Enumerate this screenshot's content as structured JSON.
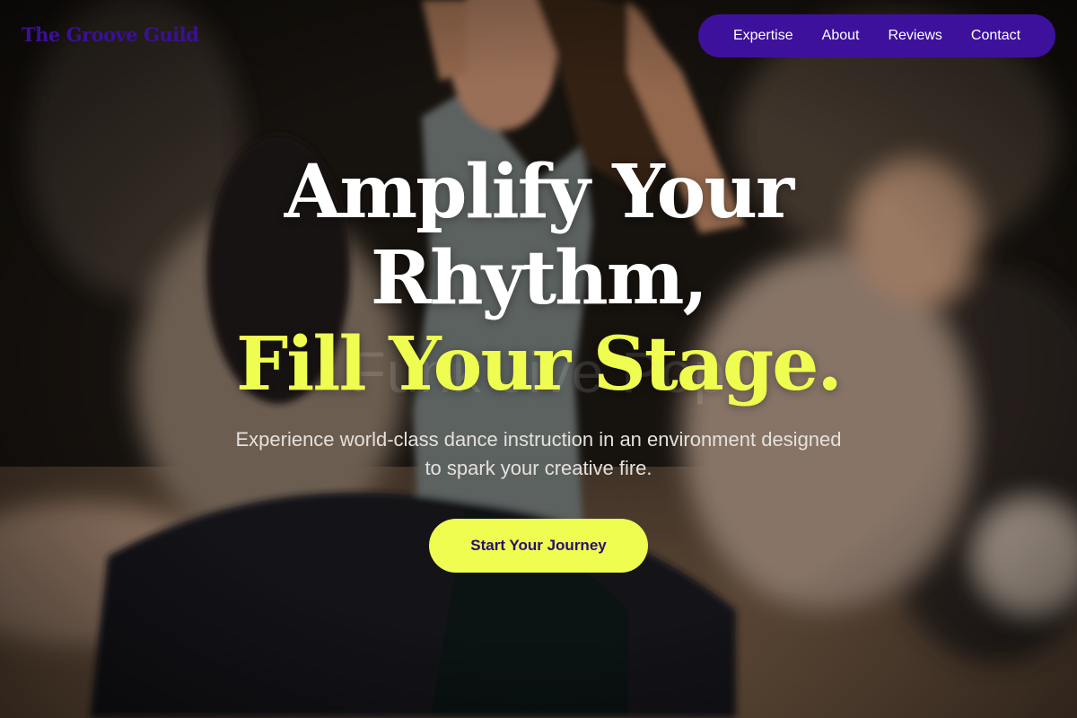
{
  "brand": {
    "name": "The Groove Guild",
    "color": "#3a1096"
  },
  "nav": {
    "background": "#3d119c",
    "items": [
      {
        "label": "Expertise"
      },
      {
        "label": "About"
      },
      {
        "label": "Reviews"
      },
      {
        "label": "Contact"
      }
    ]
  },
  "hero": {
    "headline_line1": "Amplify Your",
    "headline_line2": "Rhythm,",
    "headline_accent": "Fill Your Stage.",
    "ghost_text": "Funk Jive Pop",
    "subtitle": "Experience world-class dance instruction in an environment designed to spark your creative fire.",
    "cta_label": "Start Your Journey",
    "accent_color": "#eefd4f"
  }
}
